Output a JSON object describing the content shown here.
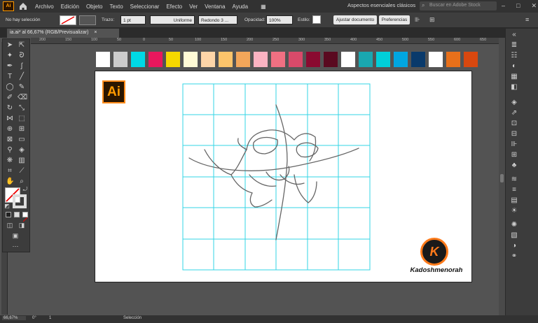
{
  "menubar": {
    "items": [
      "Archivo",
      "Edición",
      "Objeto",
      "Texto",
      "Seleccionar",
      "Efecto",
      "Ver",
      "Ventana",
      "Ayuda"
    ],
    "logo_text": "Ai",
    "workspace": "Aspectos esenciales clásicos",
    "stock_placeholder": "Buscar en Adobe Stock"
  },
  "control_bar": {
    "selection": "No hay selección",
    "stroke_label": "Trazo:",
    "stroke_weight": "1 pt",
    "stroke_profile": "Uniforme",
    "brush": "Redondo 3 ...",
    "opacity_label": "Opacidad:",
    "opacity_value": "100%",
    "style_label": "Estilo:",
    "document_setup": "Ajustar documento",
    "preferences": "Preferencias"
  },
  "tab": {
    "title": "ia.ai* al 66,67% (RGB/Previsualizar)",
    "close": "×"
  },
  "ruler": {
    "ticks": [
      "200",
      "150",
      "100",
      "50",
      "0",
      "50",
      "100",
      "150",
      "200",
      "250",
      "300",
      "350",
      "400",
      "450",
      "500",
      "550",
      "600",
      "650"
    ]
  },
  "swatches": [
    "#ffffff",
    "#cccccc",
    "#00d9e6",
    "#e8175d",
    "#f5d800",
    "#fffbd6",
    "#fdd5a8",
    "#fcc46b",
    "#f2a65a",
    "#fbb3c2",
    "#f07082",
    "#d94a6a",
    "#8a0a30",
    "#5a0a20",
    "#ffffff",
    "#1aa7b0",
    "#00cfd9",
    "#00a6e0",
    "#0a3a6b",
    "#ffffff",
    "#e8701a",
    "#d9480f"
  ],
  "artboard": {
    "ai_logo": "Ai",
    "brand_letter": "K",
    "brand_name": "Kadoshmenorah"
  },
  "status": {
    "zoom": "66,67%",
    "rotation": "0°",
    "page": "1",
    "mode": "Selección"
  }
}
